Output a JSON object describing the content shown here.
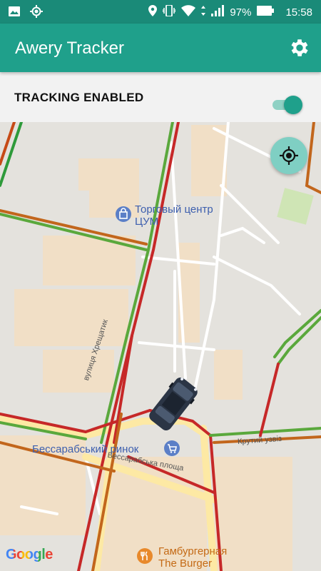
{
  "status_bar": {
    "battery_percent": "97%",
    "time": "15:58",
    "icons": [
      "image-icon",
      "gps-icon",
      "location-icon",
      "vibrate-icon",
      "wifi-icon",
      "signal-icon",
      "battery-icon"
    ]
  },
  "app_bar": {
    "title": "Awery Tracker",
    "settings_icon": "gear-icon",
    "color": "#1fa08b"
  },
  "tracking": {
    "label": "TRACKING ENABLED",
    "enabled": true
  },
  "map": {
    "locate_icon": "my-location-icon",
    "provider_logo": "Google",
    "places": [
      {
        "name_line1": "Торговый центр",
        "name_line2": "ЦУМ",
        "icon": "shopping-bag-icon"
      },
      {
        "name_line1": "Бессарабський ринок",
        "icon": "shopping-cart-icon"
      },
      {
        "name_line1": "Гамбургерная",
        "name_line2": "The Burger",
        "icon": "food-icon"
      }
    ],
    "streets": [
      "вулиця Хрещатик",
      "Крутий узвіз",
      "Бессарабська площа"
    ],
    "marker_icon": "car-icon"
  }
}
